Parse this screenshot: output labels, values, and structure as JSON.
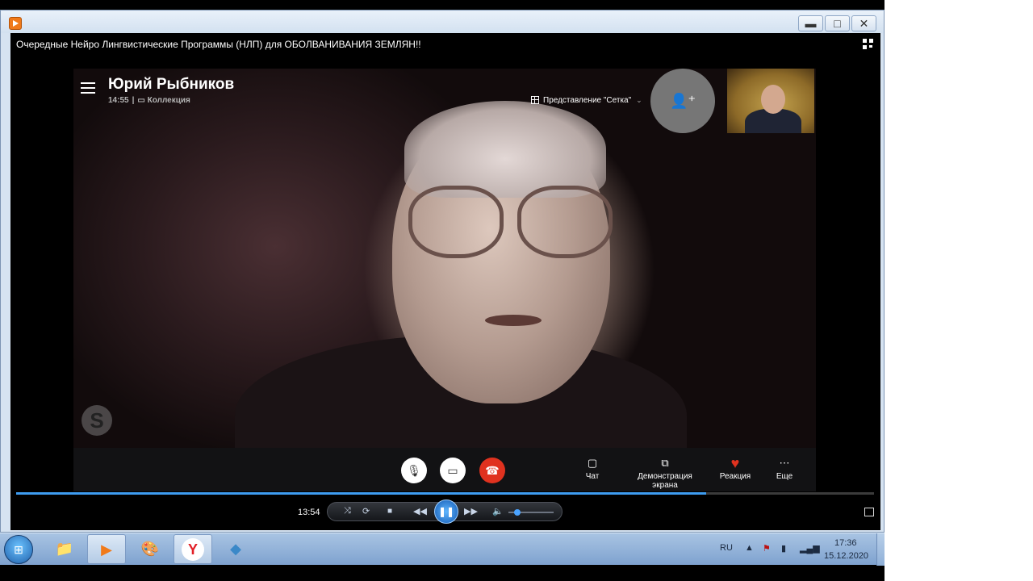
{
  "window": {
    "title_bar_buttons": {
      "minimize": "▬",
      "maximize": "□",
      "close": "✕"
    }
  },
  "player": {
    "video_title": "Очередные Нейро Лингвистические Программы (НЛП) для ОБОЛВАНИВАНИЯ ЗЕМЛЯН!!",
    "current_time": "13:54",
    "progress": 0.804,
    "volume": 0.15
  },
  "skype": {
    "caller_name": "Юрий Рыбников",
    "call_duration": "14:55",
    "collection_label": "Коллекция",
    "view_mode_label": "Представление \"Сетка\"",
    "watermark": "S",
    "toolbar": {
      "chat": "Чат",
      "share": "Демонстрация экрана",
      "reaction": "Реакция",
      "more": "Еще"
    }
  },
  "taskbar": {
    "language": "RU",
    "time": "17:36",
    "date": "15.12.2020",
    "yandex_letter": "Y"
  },
  "colors": {
    "end_call": "#e0321f",
    "seek_fill": "#3e9cf0",
    "taskbar": "#7ea2cf"
  }
}
